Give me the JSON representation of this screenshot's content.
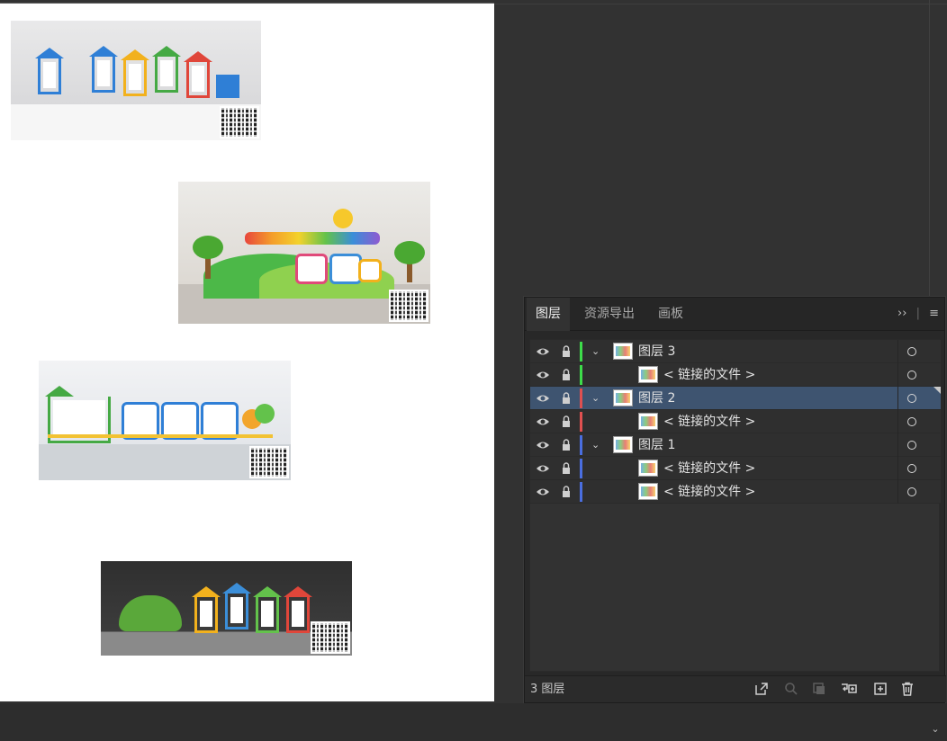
{
  "artboard": {
    "images": [
      {
        "name": "culture-wall-1"
      },
      {
        "name": "culture-wall-2"
      },
      {
        "name": "culture-wall-3"
      },
      {
        "name": "culture-wall-4"
      }
    ]
  },
  "layers_panel": {
    "tabs": [
      {
        "label": "图层",
        "active": true
      },
      {
        "label": "资源导出",
        "active": false
      },
      {
        "label": "画板",
        "active": false
      }
    ],
    "menu_expand": "››",
    "menu_sep": "|",
    "menu_icon": "hamburger-icon",
    "rows": [
      {
        "label": "图层 3",
        "kind": "layer",
        "color": "#3ddc4a",
        "expanded": true,
        "selected": false
      },
      {
        "label": "< 链接的文件 >",
        "kind": "item",
        "color": "#3ddc4a",
        "selected": false
      },
      {
        "label": "图层 2",
        "kind": "layer",
        "color": "#e05050",
        "expanded": true,
        "selected": true
      },
      {
        "label": "< 链接的文件 >",
        "kind": "item",
        "color": "#e05050",
        "selected": false
      },
      {
        "label": "图层 1",
        "kind": "layer",
        "color": "#4a6ee0",
        "expanded": true,
        "selected": false
      },
      {
        "label": "< 链接的文件 >",
        "kind": "item",
        "color": "#4a6ee0",
        "selected": false
      },
      {
        "label": "< 链接的文件 >",
        "kind": "item",
        "color": "#4a6ee0",
        "selected": false
      }
    ],
    "footer": {
      "layer_count": "3 图层",
      "tools": [
        "export-icon",
        "search-icon",
        "clip-mask-icon",
        "new-sublayer-icon",
        "new-layer-icon",
        "trash-icon"
      ]
    }
  }
}
